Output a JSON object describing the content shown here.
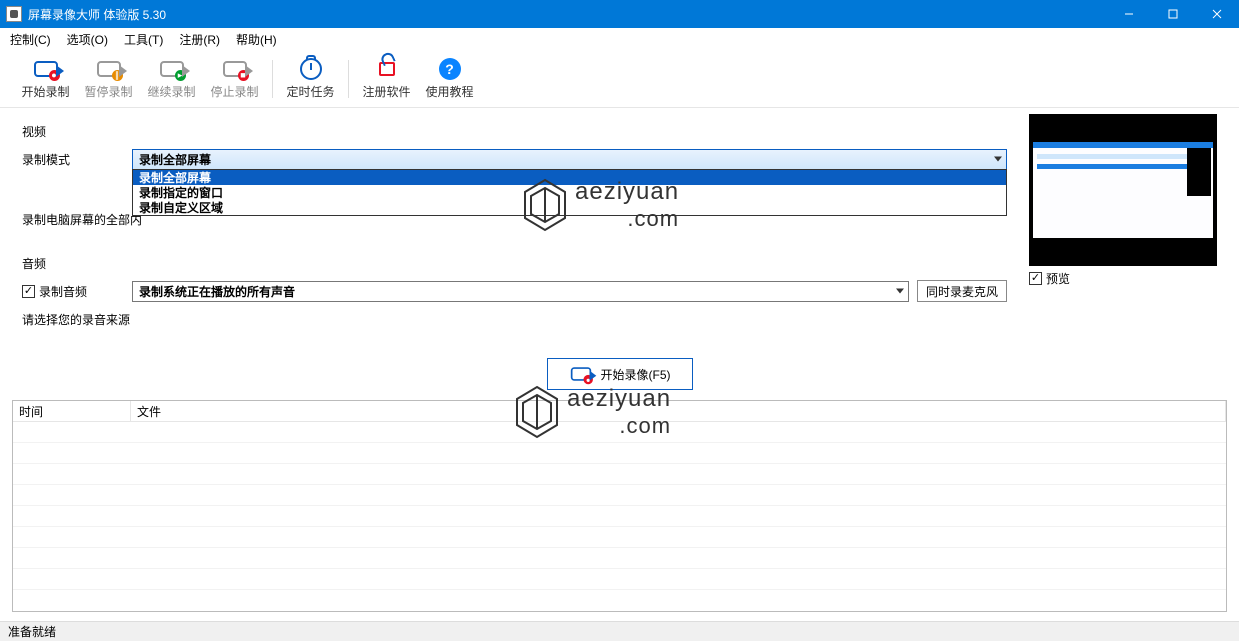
{
  "window": {
    "title": "屏幕录像大师 体验版 5.30"
  },
  "menu": {
    "control": "控制(C)",
    "options": "选项(O)",
    "tools": "工具(T)",
    "register": "注册(R)",
    "help": "帮助(H)"
  },
  "toolbar": {
    "start": "开始录制",
    "pause": "暂停录制",
    "resume": "继续录制",
    "stop": "停止录制",
    "timer": "定时任务",
    "reg": "注册软件",
    "tutorial": "使用教程"
  },
  "video": {
    "group": "视频",
    "mode_label": "录制模式",
    "mode_value": "录制全部屏幕",
    "options": {
      "full": "录制全部屏幕",
      "window": "录制指定的窗口",
      "region": "录制自定义区域"
    },
    "desc": "录制电脑屏幕的全部内"
  },
  "audio": {
    "group": "音频",
    "checkbox": "录制音频",
    "source_value": "录制系统正在播放的所有声音",
    "mic_btn": "同时录麦克风",
    "desc": "请选择您的录音来源"
  },
  "preview": {
    "checkbox": "预览"
  },
  "main_button": "开始录像(F5)",
  "table": {
    "col_time": "时间",
    "col_file": "文件"
  },
  "status": "准备就绪",
  "watermark": {
    "brand": "aeziyuan",
    "domain": ".com"
  }
}
